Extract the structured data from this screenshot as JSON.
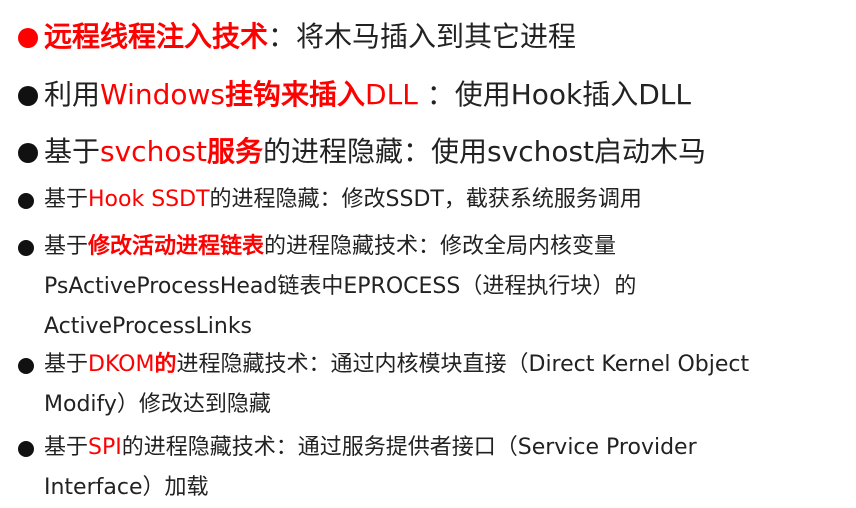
{
  "colors": {
    "highlight": "#ff0000",
    "text": "#222222",
    "background": "#ffffff"
  },
  "items": [
    {
      "highlight": "远程线程注入技术",
      "rest": "：将木马插入到其它进程"
    },
    {
      "prefix": "利用",
      "hl1": "Windows",
      "hl2": "挂钩来插入",
      "hl3": "DLL",
      "rest": " ：使用Hook插入DLL"
    },
    {
      "prefix": "基于",
      "hl1": "svchost",
      "hl2": "服务",
      "rest": "的进程隐藏：使用svchost启动木马"
    },
    {
      "prefix": "基于",
      "highlight": "Hook SSDT",
      "rest": "的进程隐藏：修改SSDT，截获系统服务调用"
    },
    {
      "prefix": "基于",
      "highlight": "修改活动进程链表",
      "rest": "的进程隐藏技术：修改全局内核变量",
      "line2": "PsActiveProcessHead链表中EPROCESS（进程执行块）的",
      "line3": "ActiveProcessLinks"
    },
    {
      "prefix": "基于",
      "hl1": "DKOM",
      "hl2": "的",
      "rest": "进程隐藏技术：通过内核模块直接（Direct Kernel Object",
      "line2": "Modify）修改达到隐藏"
    },
    {
      "prefix": "基于",
      "highlight": "SPI",
      "rest": "的进程隐藏技术：通过服务提供者接口（Service Provider",
      "line2": "Interface）加载"
    }
  ]
}
